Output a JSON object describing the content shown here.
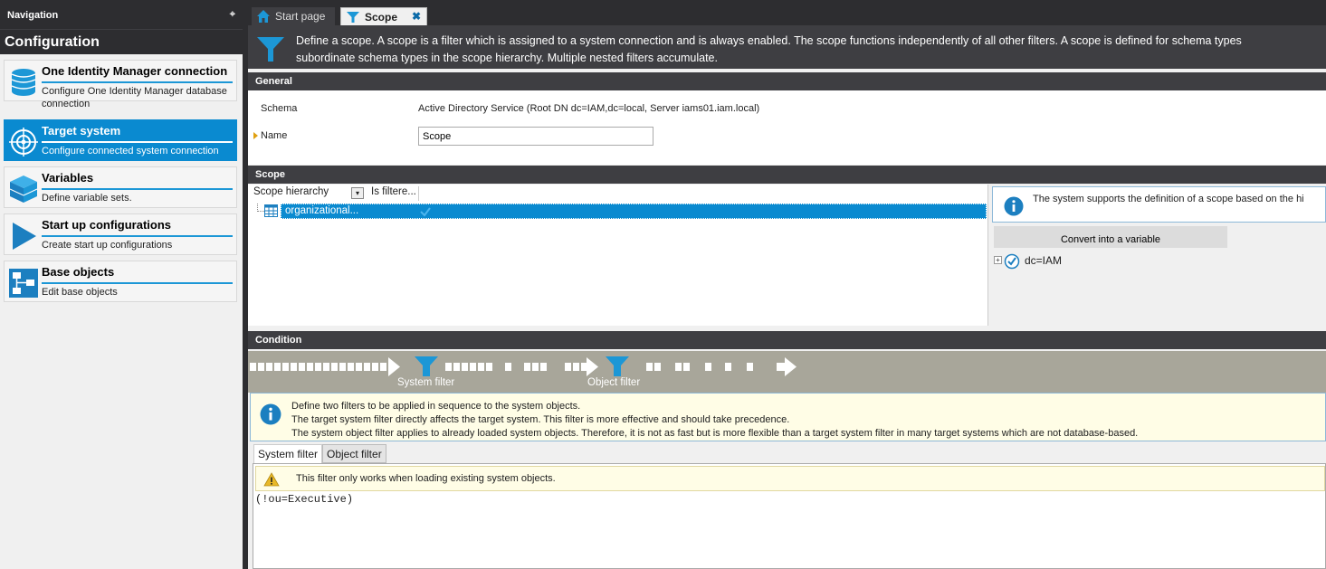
{
  "navigation": {
    "header": "Navigation",
    "pin_glyph": "⌖",
    "title": "Configuration",
    "items": [
      {
        "title": "One Identity Manager connection",
        "desc": "Configure One Identity Manager database connection",
        "icon": "database-icon"
      },
      {
        "title": "Target system",
        "desc": "Configure connected system connection",
        "icon": "target-icon",
        "selected": true
      },
      {
        "title": "Variables",
        "desc": "Define variable sets.",
        "icon": "variables-cube-icon"
      },
      {
        "title": "Start up configurations",
        "desc": "Create start up configurations",
        "icon": "play-icon"
      },
      {
        "title": "Base objects",
        "desc": "Edit base objects",
        "icon": "base-objects-icon"
      }
    ]
  },
  "tabs": [
    {
      "label": "Start page",
      "icon": "home-icon"
    },
    {
      "label": "Scope",
      "icon": "filter-icon",
      "close": "✖",
      "active": true
    }
  ],
  "banner": {
    "text": "Define a scope. A scope is a filter which is assigned to a system connection and is always enabled. The scope functions independently of all other filters. A scope is defined for schema types\nsubordinate schema types in the scope hierarchy. Multiple nested filters accumulate."
  },
  "general": {
    "header": "General",
    "schema_label": "Schema",
    "schema_value": "Active Directory Service (Root DN dc=IAM,dc=local, Server iams01.iam.local)",
    "name_label": "Name",
    "name_value": "Scope"
  },
  "scope": {
    "header": "Scope",
    "col_hierarchy": "Scope hierarchy",
    "col_dropdown": "▾",
    "col_filtered": "Is filtere...",
    "tree_item": "organizational...",
    "info_text": "The system supports the definition of a scope based on the hi",
    "convert_button": "Convert into a variable",
    "tree_root": "dc=IAM",
    "expand_glyph": "+"
  },
  "condition": {
    "header": "Condition",
    "system_filter_label": "System filter",
    "object_filter_label": "Object filter",
    "info_lines": [
      "Define two filters to be applied in sequence to the system objects.",
      "The target system filter directly affects the target system. This filter is more effective and should take precedence.",
      "The system object filter applies to already loaded system objects. Therefore, it is not as fast but is more flexible than a target system filter in many target systems which are not database-based."
    ],
    "tabs": [
      "System filter",
      "Object filter"
    ],
    "warning": "This filter only works when loading existing system objects.",
    "filter_value": "(!ou=Executive)"
  },
  "colors": {
    "accent": "#0a8ad0",
    "dark": "#2d2d30",
    "section": "#3e3e42",
    "flow": "#a8a69a",
    "info_bg": "#fffde6"
  }
}
